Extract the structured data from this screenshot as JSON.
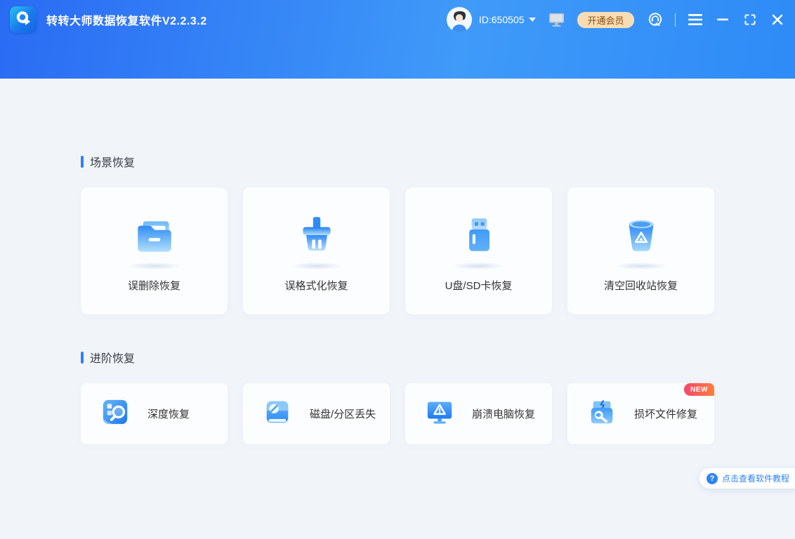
{
  "window": {
    "app_title": "转转大师数据恢复软件V2.2.3.2",
    "logo_icon": "app-logo-q-icon",
    "user": {
      "id_label": "ID:650505",
      "avatar_icon": "user-avatar",
      "dropdown_icon": "chevron-down-icon"
    },
    "device_icon": "monitor-device-icon",
    "vip_button_label": "开通会员",
    "service_icon": "customer-service-icon",
    "controls": {
      "menu_icon": "menu-icon",
      "minimize_icon": "minimize-icon",
      "maximize_icon": "maximize-icon",
      "close_icon": "close-icon"
    }
  },
  "sections": {
    "scene": {
      "title": "场景恢复",
      "cards": [
        {
          "label": "误删除恢复",
          "icon": "folder-icon"
        },
        {
          "label": "误格式化恢复",
          "icon": "broom-icon"
        },
        {
          "label": "U盘/SD卡恢复",
          "icon": "usb-drive-icon"
        },
        {
          "label": "清空回收站恢复",
          "icon": "recycle-bin-icon"
        }
      ]
    },
    "advanced": {
      "title": "进阶恢复",
      "cards": [
        {
          "label": "深度恢复",
          "icon": "deep-scan-icon"
        },
        {
          "label": "磁盘/分区丢失",
          "icon": "disk-partition-icon"
        },
        {
          "label": "崩溃电脑恢复",
          "icon": "crashed-pc-icon"
        },
        {
          "label": "损坏文件修复",
          "icon": "file-repair-icon",
          "badge": "NEW"
        }
      ]
    }
  },
  "tutorial": {
    "question_mark": "?",
    "label": "点击查看软件教程",
    "icon": "help-icon"
  },
  "colors": {
    "header_gradient_left": "#2a6bf4",
    "header_gradient_right": "#2e8bf7",
    "accent_blue": "#2f80f5",
    "page_background": "#f1f5fa",
    "card_background": "#fbfdfe",
    "vip_background": "#f8ddb4",
    "vip_text": "#8a4e14",
    "new_badge_gradient": [
      "#f8456d",
      "#fc7e3a"
    ]
  }
}
